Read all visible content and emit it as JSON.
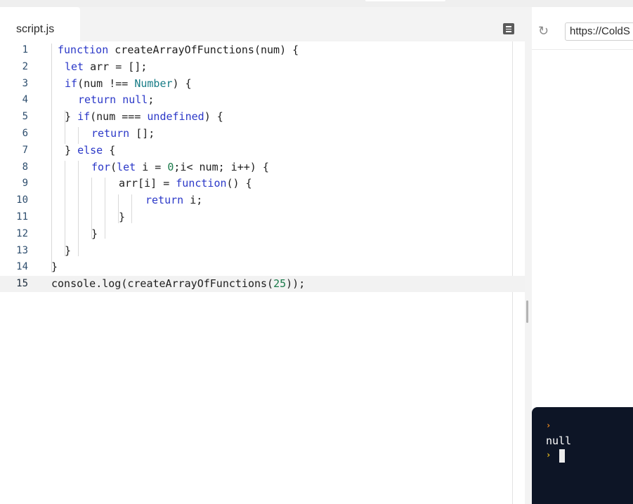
{
  "editor": {
    "tab_label": "script.js",
    "lines": [
      {
        "num": "1",
        "tokens": [
          {
            "t": "function",
            "c": "kw"
          },
          {
            "t": " createArrayOfFunctions(num) {"
          }
        ]
      },
      {
        "num": "2",
        "tokens": [
          {
            "t": "let",
            "c": "kw"
          },
          {
            "t": " arr = [];"
          }
        ]
      },
      {
        "num": "3",
        "tokens": [
          {
            "t": "if",
            "c": "kw"
          },
          {
            "t": "(num !== "
          },
          {
            "t": "Number",
            "c": "tp"
          },
          {
            "t": ") {"
          }
        ]
      },
      {
        "num": "4",
        "tokens": [
          {
            "t": "return",
            "c": "kw"
          },
          {
            "t": " "
          },
          {
            "t": "null",
            "c": "kw"
          },
          {
            "t": ";"
          }
        ]
      },
      {
        "num": "5",
        "tokens": [
          {
            "t": "} "
          },
          {
            "t": "if",
            "c": "kw"
          },
          {
            "t": "(num === "
          },
          {
            "t": "undefined",
            "c": "kw"
          },
          {
            "t": ") {"
          }
        ]
      },
      {
        "num": "6",
        "tokens": [
          {
            "t": "return",
            "c": "kw"
          },
          {
            "t": " [];"
          }
        ]
      },
      {
        "num": "7",
        "tokens": [
          {
            "t": "} "
          },
          {
            "t": "else",
            "c": "kw"
          },
          {
            "t": " {"
          }
        ]
      },
      {
        "num": "8",
        "tokens": [
          {
            "t": "for",
            "c": "kw"
          },
          {
            "t": "("
          },
          {
            "t": "let",
            "c": "kw"
          },
          {
            "t": " i = "
          },
          {
            "t": "0",
            "c": "nm"
          },
          {
            "t": ";i< num; i++) {"
          }
        ]
      },
      {
        "num": "9",
        "tokens": [
          {
            "t": "arr[i] = "
          },
          {
            "t": "function",
            "c": "kw"
          },
          {
            "t": "() {"
          }
        ]
      },
      {
        "num": "10",
        "tokens": [
          {
            "t": "return",
            "c": "kw"
          },
          {
            "t": " i;"
          }
        ]
      },
      {
        "num": "11",
        "tokens": [
          {
            "t": "}"
          }
        ]
      },
      {
        "num": "12",
        "tokens": [
          {
            "t": "}"
          }
        ]
      },
      {
        "num": "13",
        "tokens": [
          {
            "t": "}"
          }
        ]
      },
      {
        "num": "14",
        "tokens": [
          {
            "t": "}"
          }
        ]
      },
      {
        "num": "15",
        "tokens": [
          {
            "t": "console.log(createArrayOfFunctions("
          },
          {
            "t": "25",
            "c": "nm"
          },
          {
            "t": "));"
          }
        ]
      }
    ],
    "active_line": "15",
    "icons": {
      "format": "document-icon"
    }
  },
  "preview": {
    "url": "https://ColdS",
    "reload_icon": "reload-icon"
  },
  "console": {
    "output": "null",
    "prompt_color": "#f28c1e",
    "input_prompt_color": "#f2c21e"
  },
  "colors": {
    "keyword": "#2b38c8",
    "type": "#177c86",
    "number": "#1a7a4a"
  }
}
